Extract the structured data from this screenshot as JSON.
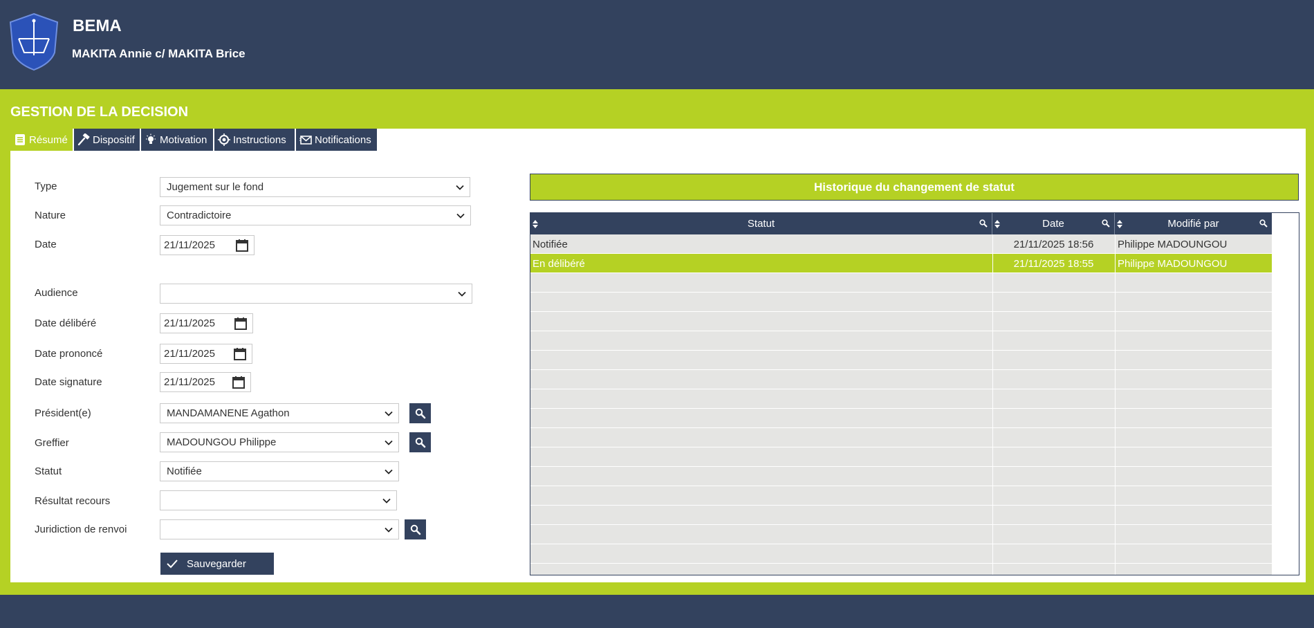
{
  "header": {
    "app_name": "BEMA",
    "case_name": "MAKITA Annie c/ MAKITA Brice"
  },
  "section_title": "GESTION DE LA DECISION",
  "tabs": [
    {
      "label": "Résumé",
      "icon": "document-icon",
      "active": true
    },
    {
      "label": "Dispositif",
      "icon": "gavel-icon",
      "active": false
    },
    {
      "label": "Motivation",
      "icon": "lightbulb-icon",
      "active": false
    },
    {
      "label": "Instructions",
      "icon": "target-icon",
      "active": false
    },
    {
      "label": "Notifications",
      "icon": "envelope-icon",
      "active": false
    }
  ],
  "form": {
    "type": {
      "label": "Type",
      "value": "Jugement sur le fond"
    },
    "nature": {
      "label": "Nature",
      "value": "Contradictoire"
    },
    "date": {
      "label": "Date",
      "value": "21/11/2025"
    },
    "audience": {
      "label": "Audience",
      "value": ""
    },
    "date_delibere": {
      "label": "Date délibéré",
      "value": "21/11/2025"
    },
    "date_prononce": {
      "label": "Date prononcé",
      "value": "21/11/2025"
    },
    "date_signature": {
      "label": "Date signature",
      "value": "21/11/2025"
    },
    "president": {
      "label": "Président(e)",
      "value": "MANDAMANENE Agathon"
    },
    "greffier": {
      "label": "Greffier",
      "value": "MADOUNGOU Philippe"
    },
    "statut": {
      "label": "Statut",
      "value": "Notifiée"
    },
    "resultat_recours": {
      "label": "Résultat recours",
      "value": ""
    },
    "juridiction_renvoi": {
      "label": "Juridiction de renvoi",
      "value": ""
    },
    "save_label": "Sauvegarder"
  },
  "history": {
    "title": "Historique du changement de statut",
    "columns": [
      "Statut",
      "Date",
      "Modifié par"
    ],
    "rows": [
      {
        "statut": "Notifiée",
        "date": "21/11/2025 18:56",
        "by": "Philippe MADOUNGOU",
        "selected": false
      },
      {
        "statut": "En délibéré",
        "date": "21/11/2025 18:55",
        "by": "Philippe MADOUNGOU",
        "selected": true
      }
    ]
  },
  "colors": {
    "navy": "#33425e",
    "accent_green": "#b5d124",
    "row_grey": "#e5e5e3"
  }
}
